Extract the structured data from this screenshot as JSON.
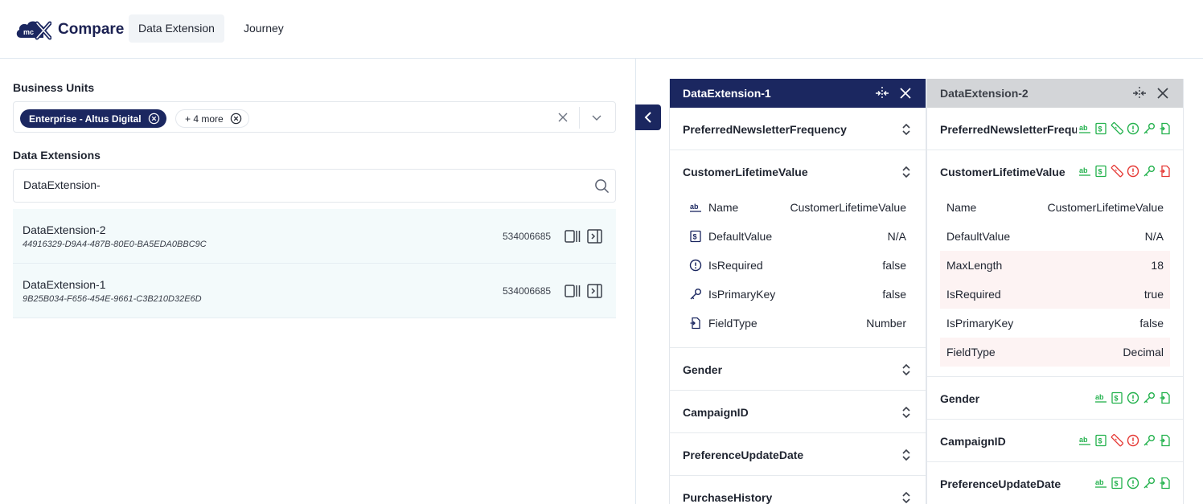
{
  "header": {
    "logo_text": "mc",
    "app_title": "Compare",
    "tabs": [
      {
        "label": "Data Extension",
        "active": true
      },
      {
        "label": "Journey",
        "active": false
      }
    ]
  },
  "filters": {
    "business_units_label": "Business Units",
    "selected_unit": "Enterprise - Altus Digital",
    "more_units": "+ 4 more",
    "data_extensions_label": "Data Extensions",
    "search_value": "DataExtension-"
  },
  "results": [
    {
      "name": "DataExtension-2",
      "id": "44916329-D9A4-487B-80E0-BA5EDA0BBC9C",
      "count": "534006685"
    },
    {
      "name": "DataExtension-1",
      "id": "9B25B034-F656-454E-9661-C3B210D32E6D",
      "count": "534006685"
    }
  ],
  "compare": {
    "left": {
      "title": "DataExtension-1",
      "fields": {
        "f1": "PreferredNewsletterFrequency",
        "f2": "CustomerLifetimeValue",
        "f3": "Gender",
        "f4": "CampaignID",
        "f5": "PreferenceUpdateDate",
        "f6": "PurchaseHistory"
      },
      "props": [
        {
          "label": "Name",
          "value": "CustomerLifetimeValue",
          "icon": "text-type-icon"
        },
        {
          "label": "DefaultValue",
          "value": "N/A",
          "icon": "default-value-icon"
        },
        {
          "label": "IsRequired",
          "value": "false",
          "icon": "required-icon"
        },
        {
          "label": "IsPrimaryKey",
          "value": "false",
          "icon": "key-icon"
        },
        {
          "label": "FieldType",
          "value": "Number",
          "icon": "field-type-icon"
        }
      ]
    },
    "right": {
      "title": "DataExtension-2",
      "fields": {
        "f1": "PreferredNewsletterFrequency",
        "f2": "CustomerLifetimeValue",
        "f3": "Gender",
        "f4": "CampaignID",
        "f5": "PreferenceUpdateDate"
      },
      "props": [
        {
          "label": "Name",
          "value": "CustomerLifetimeValue",
          "diff": false
        },
        {
          "label": "DefaultValue",
          "value": "N/A",
          "diff": false
        },
        {
          "label": "MaxLength",
          "value": "18",
          "diff": true
        },
        {
          "label": "IsRequired",
          "value": "true",
          "diff": true
        },
        {
          "label": "IsPrimaryKey",
          "value": "false",
          "diff": false
        },
        {
          "label": "FieldType",
          "value": "Decimal",
          "diff": true
        }
      ]
    }
  },
  "colors": {
    "navy": "#1b2760",
    "match_green": "#22b14c",
    "diff_red": "#e53935",
    "diff_row_bg": "#fdf3f3",
    "row_bg": "#f3fafb"
  }
}
